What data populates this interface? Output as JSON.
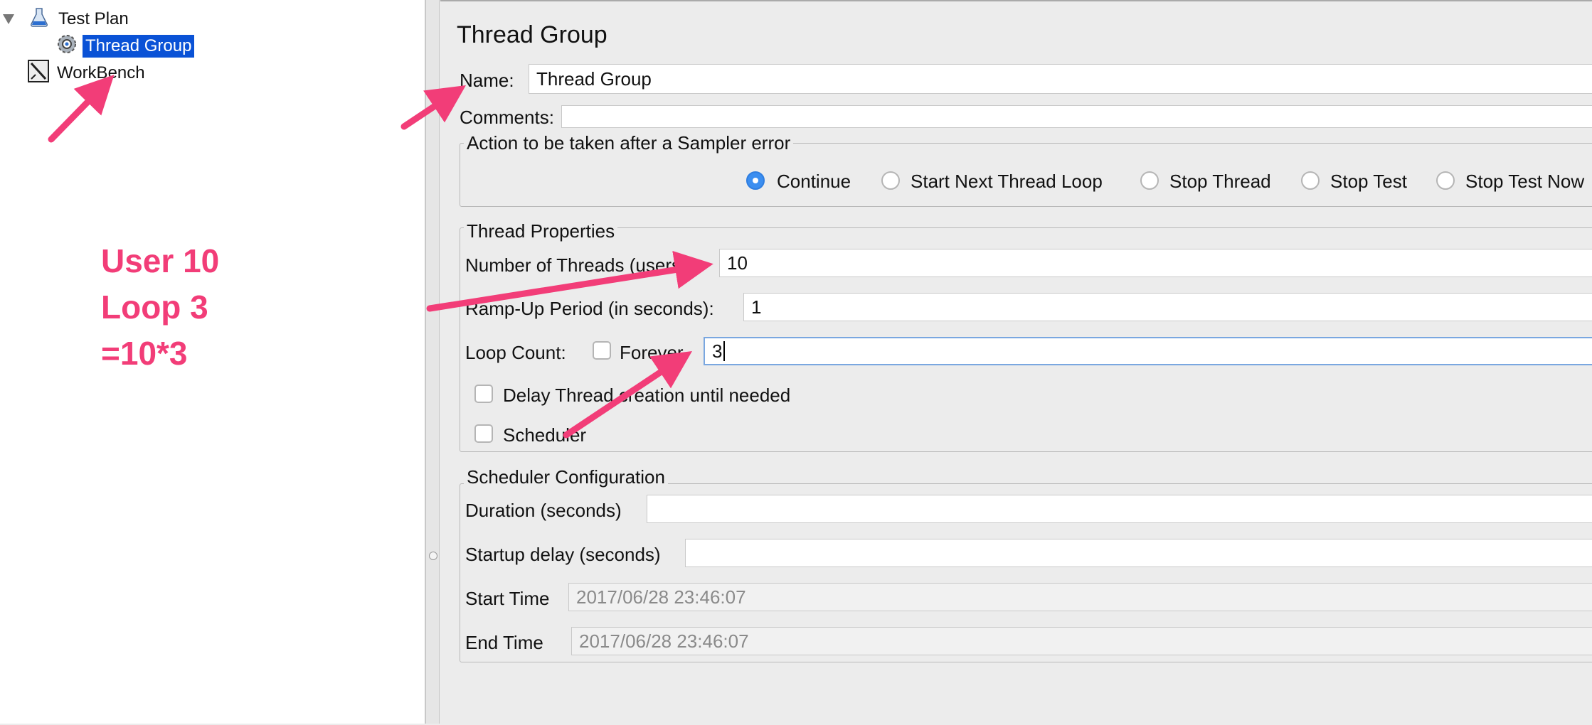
{
  "tree": {
    "items": [
      {
        "label": "Test Plan"
      },
      {
        "label": "Thread Group"
      },
      {
        "label": "WorkBench"
      }
    ]
  },
  "panel": {
    "title": "Thread Group",
    "name_label": "Name:",
    "name_value": "Thread Group",
    "comments_label": "Comments:",
    "comments_value": "",
    "sampler_error": {
      "legend": "Action to be taken after a Sampler error",
      "options": [
        "Continue",
        "Start Next Thread Loop",
        "Stop Thread",
        "Stop Test",
        "Stop Test Now"
      ],
      "selected": "Continue"
    },
    "thread_props": {
      "legend": "Thread Properties",
      "threads_label": "Number of Threads (users):",
      "threads_value": "10",
      "rampup_label": "Ramp-Up Period (in seconds):",
      "rampup_value": "1",
      "loop_label": "Loop Count:",
      "forever_label": "Forever",
      "loop_value": "3",
      "delay_label": "Delay Thread creation until needed",
      "scheduler_label": "Scheduler"
    },
    "scheduler_config": {
      "legend": "Scheduler Configuration",
      "duration_label": "Duration (seconds)",
      "duration_value": "",
      "startup_label": "Startup delay (seconds)",
      "startup_value": "",
      "start_label": "Start Time",
      "start_value": "2017/06/28 23:46:07",
      "end_label": "End Time",
      "end_value": "2017/06/28 23:46:07"
    }
  },
  "annotation": {
    "line1": "User 10",
    "line2": "Loop 3",
    "line3": "=10*3"
  },
  "colors": {
    "accent": "#f23d78",
    "selection": "#0a52d6",
    "radio": "#3b8ef0"
  }
}
